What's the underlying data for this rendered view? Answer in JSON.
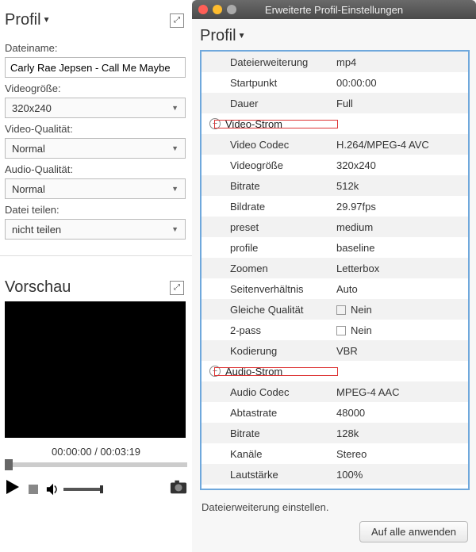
{
  "left": {
    "profil_title": "Profil",
    "form": {
      "filename_label": "Dateiname:",
      "filename_value": "Carly Rae Jepsen - Call Me Maybe",
      "videosize_label": "Videogröße:",
      "videosize_value": "320x240",
      "videoqual_label": "Video-Qualität:",
      "videoqual_value": "Normal",
      "audioqual_label": "Audio-Qualität:",
      "audioqual_value": "Normal",
      "split_label": "Datei teilen:",
      "split_value": "nicht teilen"
    },
    "vorschau_title": "Vorschau",
    "time_current": "00:00:00",
    "time_total": "00:03:19"
  },
  "right": {
    "window_title": "Erweiterte Profil-Einstellungen",
    "profil_title": "Profil",
    "rows": {
      "ext_k": "Dateierweiterung",
      "ext_v": "mp4",
      "start_k": "Startpunkt",
      "start_v": "00:00:00",
      "dur_k": "Dauer",
      "dur_v": "Full",
      "group_video": "Video-Strom",
      "vcodec_k": "Video Codec",
      "vcodec_v": "H.264/MPEG-4 AVC",
      "vsize_k": "Videogröße",
      "vsize_v": "320x240",
      "vbit_k": "Bitrate",
      "vbit_v": "512k",
      "vfps_k": "Bildrate",
      "vfps_v": "29.97fps",
      "preset_k": "preset",
      "preset_v": "medium",
      "profile_k": "profile",
      "profile_v": "baseline",
      "zoom_k": "Zoomen",
      "zoom_v": "Letterbox",
      "aspect_k": "Seitenverhältnis",
      "aspect_v": "Auto",
      "sameq_k": "Gleiche Qualität",
      "sameq_v": "Nein",
      "pass_k": "2-pass",
      "pass_v": "Nein",
      "enc_k": "Kodierung",
      "enc_v": "VBR",
      "group_audio": "Audio-Strom",
      "acodec_k": "Audio Codec",
      "acodec_v": "MPEG-4 AAC",
      "asr_k": "Abtastrate",
      "asr_v": "48000",
      "abit_k": "Bitrate",
      "abit_v": "128k",
      "ach_k": "Kanäle",
      "ach_v": "Stereo",
      "avol_k": "Lautstärke",
      "avol_v": "100%"
    },
    "hint": "Dateierweiterung einstellen.",
    "apply_label": "Auf alle anwenden"
  }
}
